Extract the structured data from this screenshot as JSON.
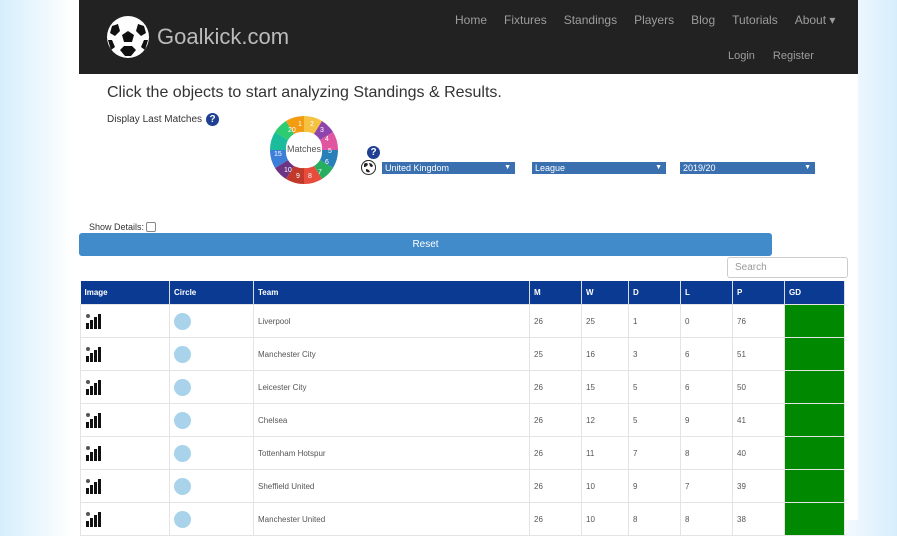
{
  "brand": {
    "name": "Goalkick.com"
  },
  "nav": {
    "links": [
      "Home",
      "Fixtures",
      "Standings",
      "Players",
      "Blog",
      "Tutorials",
      "About ▾"
    ],
    "login": "Login",
    "register": "Register"
  },
  "headline": "Click the objects to start analyzing Standings & Results.",
  "display_last": {
    "label": "Display Last Matches",
    "help": "?"
  },
  "matches_wheel": {
    "label": "Matches",
    "numbers": [
      "20",
      "1",
      "2",
      "3",
      "4",
      "5",
      "6",
      "7",
      "8",
      "9",
      "10",
      "15"
    ]
  },
  "filters": {
    "country": "United Kingdom",
    "competition": "League",
    "season": "2019/20",
    "help": "?",
    "arrow": "▼"
  },
  "show_details": {
    "label": "Show Details:"
  },
  "reset_label": "Reset",
  "search": {
    "placeholder": "Search"
  },
  "table": {
    "headers": [
      "Image",
      "Circle",
      "Team",
      "M",
      "W",
      "D",
      "L",
      "P",
      "GD"
    ],
    "rows": [
      {
        "team": "Liverpool",
        "m": "26",
        "w": "25",
        "d": "1",
        "l": "0",
        "p": "76",
        "gd": ""
      },
      {
        "team": "Manchester City",
        "m": "25",
        "w": "16",
        "d": "3",
        "l": "6",
        "p": "51",
        "gd": ""
      },
      {
        "team": "Leicester City",
        "m": "26",
        "w": "15",
        "d": "5",
        "l": "6",
        "p": "50",
        "gd": ""
      },
      {
        "team": "Chelsea",
        "m": "26",
        "w": "12",
        "d": "5",
        "l": "9",
        "p": "41",
        "gd": ""
      },
      {
        "team": "Tottenham Hotspur",
        "m": "26",
        "w": "11",
        "d": "7",
        "l": "8",
        "p": "40",
        "gd": ""
      },
      {
        "team": "Sheffield United",
        "m": "26",
        "w": "10",
        "d": "9",
        "l": "7",
        "p": "39",
        "gd": ""
      },
      {
        "team": "Manchester United",
        "m": "26",
        "w": "10",
        "d": "8",
        "l": "8",
        "p": "38",
        "gd": ""
      }
    ]
  },
  "colors": {
    "navbar": "#222222",
    "header_blue": "#0b3a93",
    "reset_blue": "#428bca",
    "gd_green": "#008800",
    "circle": "#a8d3ea"
  },
  "icons": {
    "logo": "soccer-ball-icon",
    "help": "question-circle-icon",
    "globe": "globe-icon",
    "row_image": "form-bars-icon"
  }
}
